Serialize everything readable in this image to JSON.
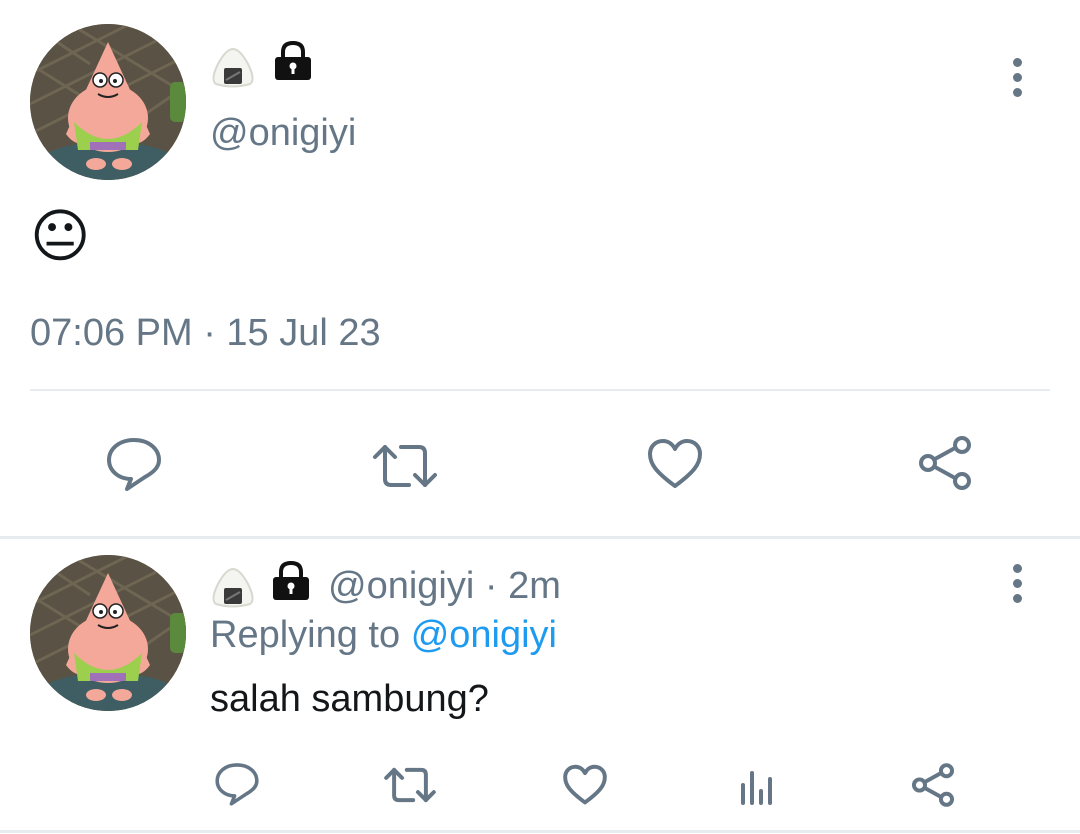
{
  "main_tweet": {
    "handle": "@onigiyi",
    "emoji": "😐",
    "timestamp": "07:06 PM · 15 Jul 23",
    "badge_icons": [
      "onigiri-icon",
      "lock-icon"
    ]
  },
  "actions_main": [
    "reply-icon",
    "retweet-icon",
    "like-icon",
    "share-icon"
  ],
  "reply_tweet": {
    "handle": "@onigiyi",
    "time": "· 2m",
    "replying_prefix": "Replying to",
    "replying_handle": "@onigiyi",
    "text": "salah sambung?"
  },
  "actions_reply": [
    "reply-icon",
    "retweet-icon",
    "like-icon",
    "views-icon",
    "share-icon"
  ],
  "colors": {
    "muted": "#657786",
    "link": "#1d9bf0",
    "divider": "#e6ecf0"
  }
}
